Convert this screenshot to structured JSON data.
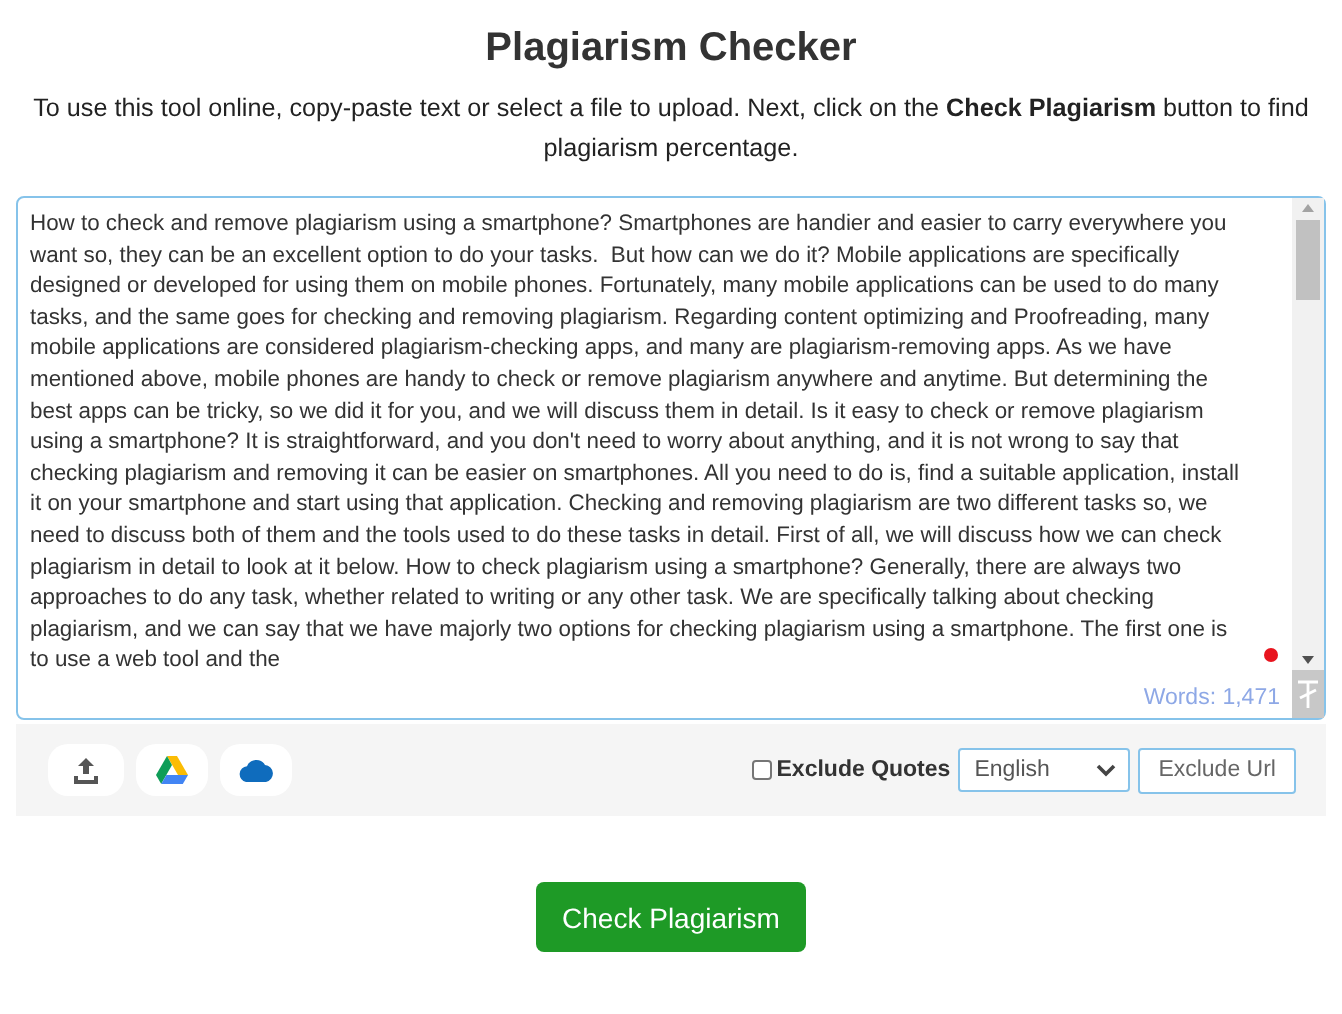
{
  "title": "Plagiarism Checker",
  "intro": "To use this tool online, copy-paste text or select a file to upload. Next, click on the **Check Plagiarism** button to find plagiarism percentage.",
  "editor": {
    "text": "How to check and remove plagiarism using a smartphone? Smartphones are handier and easier to carry everywhere you want so, they can be an excellent option to do your tasks.  But how can we do it? Mobile applications are specifically designed or developed for using them on mobile phones. Fortunately, many mobile applications can be used to do many tasks, and the same goes for checking and removing plagiarism. Regarding content optimizing and Proofreading, many mobile applications are considered plagiarism-checking apps, and many are plagiarism-removing apps. As we have mentioned above, mobile phones are handy to check or remove plagiarism anywhere and anytime. But determining the best apps can be tricky, so we did it for you, and we will discuss them in detail. Is it easy to check or remove plagiarism using a smartphone? It is straightforward, and you don't need to worry about anything, and it is not wrong to say that checking plagiarism and removing it can be easier on smartphones. All you need to do is, find a suitable application, install it on your smartphone and start using that application. Checking and removing plagiarism are two different tasks so, we need to discuss both of them and the tools used to do these tasks in detail. First of all, we will discuss how we can check plagiarism in detail to look at it below. How to check plagiarism using a smartphone? Generally, there are always two approaches to do any task, whether related to writing or any other task. We are specifically talking about checking plagiarism, and we can say that we have majorly two options for checking plagiarism using a smartphone. The first one is to use a web tool and the",
    "word_count": "Words: 1,471"
  },
  "upload_buttons": [
    {
      "kind": "upload"
    },
    {
      "kind": "drive"
    },
    {
      "kind": "cloud"
    }
  ],
  "exclude_quotes": {
    "label": "Exclude Quotes",
    "checked": false
  },
  "language": {
    "value": "English"
  },
  "exclude_url_button": "Exclude Url",
  "check_button": "Check Plagiarism"
}
